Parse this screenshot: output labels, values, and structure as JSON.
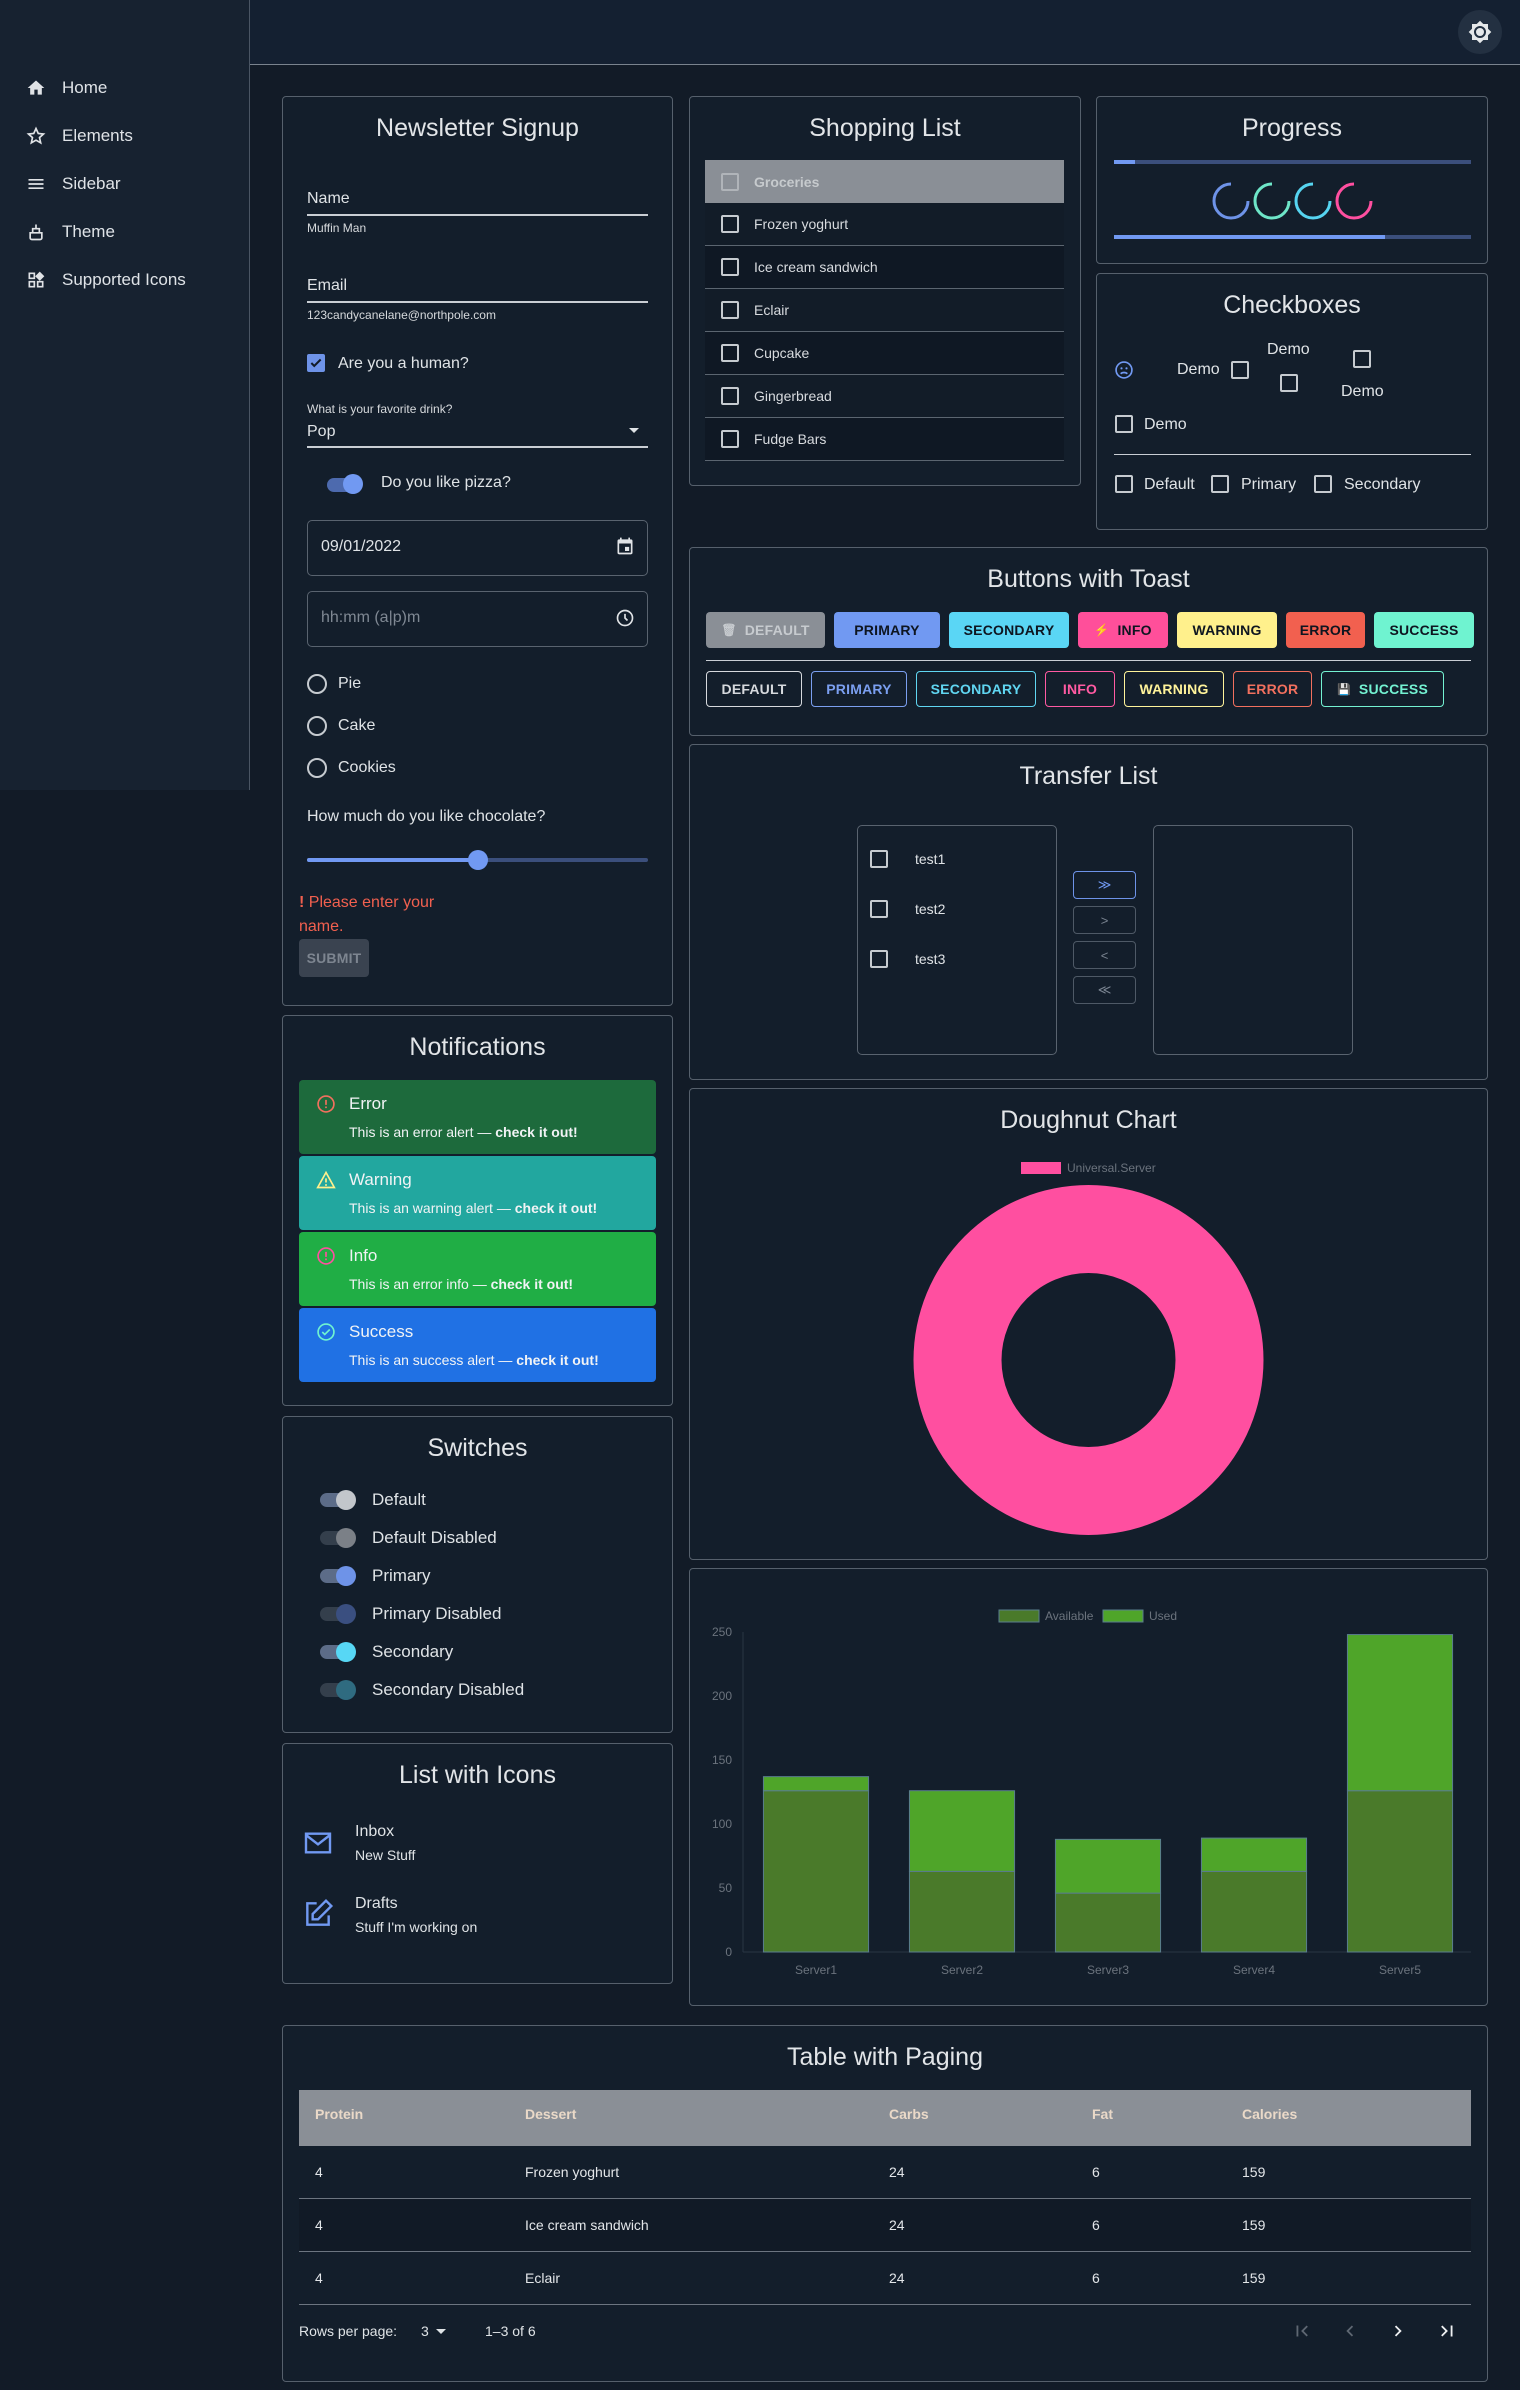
{
  "sidebar": {
    "items": [
      {
        "label": "Home",
        "icon": "home-icon"
      },
      {
        "label": "Elements",
        "icon": "star-icon"
      },
      {
        "label": "Sidebar",
        "icon": "menu-icon"
      },
      {
        "label": "Theme",
        "icon": "theme-icon"
      },
      {
        "label": "Supported Icons",
        "icon": "widgets-icon"
      }
    ]
  },
  "topbar": {
    "theme_toggle_icon": "brightness-icon"
  },
  "newsletter": {
    "title": "Newsletter Signup",
    "name_label": "Name",
    "name_value": "Muffin Man",
    "email_label": "Email",
    "email_value": "123candycanelane@northpole.com",
    "human_label": "Are you a human?",
    "human_checked": true,
    "drink_label": "What is your favorite drink?",
    "drink_value": "Pop",
    "pizza_label": "Do you like pizza?",
    "pizza_on": true,
    "date_value": "09/01/2022",
    "time_placeholder": "hh:mm (a|p)m",
    "radios": [
      "Pie",
      "Cake",
      "Cookies"
    ],
    "chocolate_label": "How much do you like chocolate?",
    "chocolate_level": 0.5,
    "error_icon": "!",
    "error_line1": "Please enter your",
    "error_line2": "name.",
    "submit_label": "SUBMIT"
  },
  "shopping": {
    "title": "Shopping List",
    "items": [
      "Groceries",
      "Frozen yoghurt",
      "Ice cream sandwich",
      "Eclair",
      "Cupcake",
      "Gingerbread",
      "Fudge Bars"
    ]
  },
  "progress": {
    "title": "Progress",
    "bar1_fraction": 0.06,
    "bar2_fraction": 0.76,
    "spinner_colors": [
      "#6e93e8",
      "#6ee6c8",
      "#56d4f0",
      "#ff4fa0"
    ]
  },
  "checkboxes": {
    "title": "Checkboxes",
    "demo_labels": [
      "Demo",
      "Demo",
      "Demo",
      "Demo"
    ],
    "colored": [
      "Default",
      "Primary",
      "Secondary"
    ]
  },
  "buttons": {
    "title": "Buttons with Toast",
    "contained": [
      {
        "label": "DEFAULT",
        "bg": "#8a8f96",
        "fg": "#c7cbcf",
        "icon": "trash-icon"
      },
      {
        "label": "PRIMARY",
        "bg": "#7199f2",
        "fg": "#0e1520"
      },
      {
        "label": "SECONDARY",
        "bg": "#5ad6f5",
        "fg": "#0e1520"
      },
      {
        "label": "INFO",
        "bg": "#ff4f9a",
        "fg": "#0e1520",
        "icon": "bolt-icon"
      },
      {
        "label": "WARNING",
        "bg": "#fff08c",
        "fg": "#0e1520"
      },
      {
        "label": "ERROR",
        "bg": "#f2604f",
        "fg": "#0e1520"
      },
      {
        "label": "SUCCESS",
        "bg": "#6ff3d0",
        "fg": "#0e1520"
      }
    ],
    "outlined": [
      {
        "label": "DEFAULT",
        "color": "#d6d9dd"
      },
      {
        "label": "PRIMARY",
        "color": "#7b9ff0"
      },
      {
        "label": "SECONDARY",
        "color": "#60d6f2"
      },
      {
        "label": "INFO",
        "color": "#ff5aa2"
      },
      {
        "label": "WARNING",
        "color": "#fff39a"
      },
      {
        "label": "ERROR",
        "color": "#f2705e"
      },
      {
        "label": "SUCCESS",
        "color": "#74f2d2",
        "icon": "save-icon"
      }
    ]
  },
  "transfer": {
    "title": "Transfer List",
    "left": [
      "test1",
      "test2",
      "test3"
    ],
    "right": [],
    "buttons": [
      "≫",
      ">",
      "<",
      "≪"
    ]
  },
  "doughnut": {
    "title": "Doughnut Chart"
  },
  "notifications": {
    "title": "Notifications",
    "alerts": [
      {
        "title": "Error",
        "msg": "This is an error alert — ",
        "strong": "check it out!",
        "bg": "#1d6a3c",
        "icon_color": "#f2705e",
        "icon": "error-icon"
      },
      {
        "title": "Warning",
        "msg": "This is an warning alert — ",
        "strong": "check it out!",
        "bg": "#22a79f",
        "icon_color": "#fff08c",
        "icon": "warning-icon"
      },
      {
        "title": "Info",
        "msg": "This is an error info — ",
        "strong": "check it out!",
        "bg": "#20ae45",
        "icon_color": "#ff4fa0",
        "icon": "info-icon"
      },
      {
        "title": "Success",
        "msg": "This is an success alert — ",
        "strong": "check it out!",
        "bg": "#2071e4",
        "icon_color": "#6ff3d0",
        "icon": "success-icon"
      }
    ]
  },
  "switches": {
    "title": "Switches",
    "items": [
      {
        "label": "Default",
        "on": true,
        "disabled": false,
        "color": "#c2c6cb"
      },
      {
        "label": "Default Disabled",
        "on": true,
        "disabled": true,
        "color": "#7b8087"
      },
      {
        "label": "Primary",
        "on": true,
        "disabled": false,
        "color": "#6e93e8"
      },
      {
        "label": "Primary Disabled",
        "on": true,
        "disabled": true,
        "color": "#3a4f80"
      },
      {
        "label": "Secondary",
        "on": true,
        "disabled": false,
        "color": "#57d7f5"
      },
      {
        "label": "Secondary Disabled",
        "on": true,
        "disabled": true,
        "color": "#2f6b80"
      }
    ]
  },
  "list_icons": {
    "title": "List with Icons",
    "items": [
      {
        "primary": "Inbox",
        "secondary": "New Stuff",
        "icon": "mail-icon"
      },
      {
        "primary": "Drafts",
        "secondary": "Stuff I'm working on",
        "icon": "edit-icon"
      }
    ]
  },
  "table": {
    "title": "Table with Paging",
    "headers": [
      "Protein",
      "Dessert",
      "Carbs",
      "Fat",
      "Calories"
    ],
    "rows": [
      [
        "4",
        "Frozen yoghurt",
        "24",
        "6",
        "159"
      ],
      [
        "4",
        "Ice cream sandwich",
        "24",
        "6",
        "159"
      ],
      [
        "4",
        "Eclair",
        "24",
        "6",
        "159"
      ]
    ],
    "rows_per_page_label": "Rows per page:",
    "rows_per_page": "3",
    "range": "1–3 of 6"
  },
  "chart_data": [
    {
      "type": "pie",
      "legend": [
        "Universal.Server"
      ],
      "values": [
        100
      ],
      "colors": [
        "#ff4fa0"
      ],
      "legend_position": "top"
    },
    {
      "type": "bar",
      "stacked": true,
      "categories": [
        "Server1",
        "Server2",
        "Server3",
        "Server4",
        "Server5"
      ],
      "series": [
        {
          "name": "Available",
          "values": [
            126,
            63,
            46,
            63,
            126
          ],
          "color": "#4a7a2a"
        },
        {
          "name": "Used",
          "values": [
            11,
            63,
            42,
            26,
            122
          ],
          "color": "#4fa529"
        }
      ],
      "ylim": [
        0,
        250
      ],
      "yticks": [
        0,
        50,
        100,
        150,
        200,
        250
      ],
      "legend_position": "top",
      "grid": false
    }
  ]
}
